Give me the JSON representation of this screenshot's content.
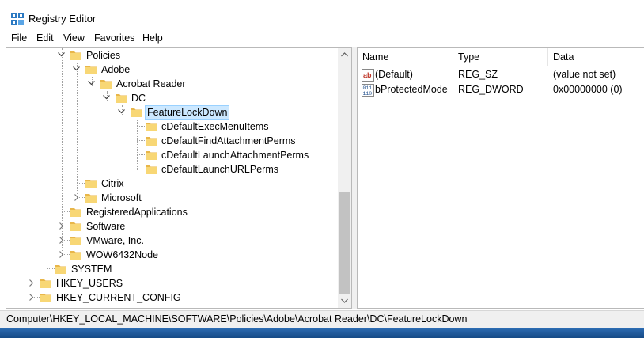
{
  "window": {
    "title": "Registry Editor"
  },
  "menu": [
    "File",
    "Edit",
    "View",
    "Favorites",
    "Help"
  ],
  "tree": {
    "policies": "Policies",
    "adobe": "Adobe",
    "acrobat_reader": "Acrobat Reader",
    "dc": "DC",
    "feature_lockdown": "FeatureLockDown",
    "c_default_exec_menu_items": "cDefaultExecMenuItems",
    "c_default_find_attachment_perms": "cDefaultFindAttachmentPerms",
    "c_default_launch_attachment_perms": "cDefaultLaunchAttachmentPerms",
    "c_default_launch_url_perms": "cDefaultLaunchURLPerms",
    "citrix": "Citrix",
    "microsoft": "Microsoft",
    "registered_applications": "RegisteredApplications",
    "software": "Software",
    "vmware": "VMware, Inc.",
    "wow6432node": "WOW6432Node",
    "system": "SYSTEM",
    "hkey_users": "HKEY_USERS",
    "hkey_current_config": "HKEY_CURRENT_CONFIG"
  },
  "columns": {
    "name": "Name",
    "type": "Type",
    "data": "Data"
  },
  "values": [
    {
      "icon": "string-value-icon",
      "name": "(Default)",
      "type": "REG_SZ",
      "data": "(value not set)"
    },
    {
      "icon": "binary-value-icon",
      "name": "bProtectedMode",
      "type": "REG_DWORD",
      "data": "0x00000000 (0)"
    }
  ],
  "status": {
    "path": "Computer\\HKEY_LOCAL_MACHINE\\SOFTWARE\\Policies\\Adobe\\Acrobat Reader\\DC\\FeatureLockDown"
  },
  "colors": {
    "selection": "#cce8ff",
    "folder": "#f8d775",
    "taskbar": "#1e5a9e"
  }
}
